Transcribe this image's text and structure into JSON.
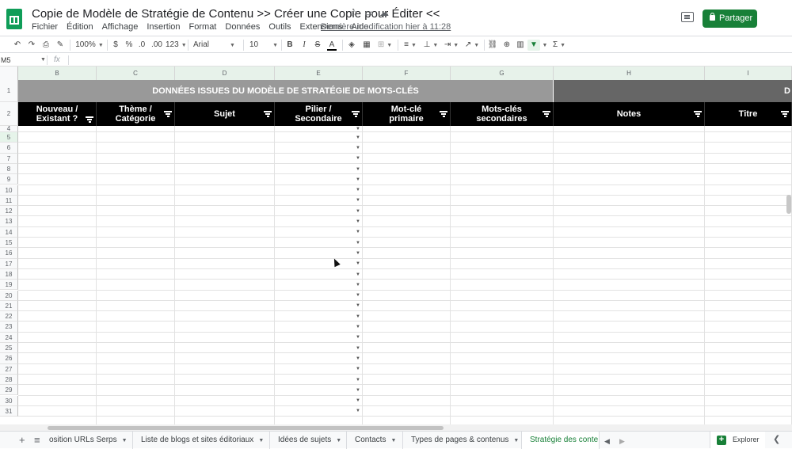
{
  "app": {
    "title": "Copie de Modèle de Stratégie de Contenu >> Créer une Copie pour Éditer <<",
    "last_edit": "Dernière modification hier à 11:28",
    "share_label": "Partager"
  },
  "menu": [
    "Fichier",
    "Édition",
    "Affichage",
    "Insertion",
    "Format",
    "Données",
    "Outils",
    "Extensions",
    "Aide"
  ],
  "toolbar": {
    "zoom": "100%",
    "currency": "$",
    "percent": "%",
    "dec_decrease": ".0",
    "dec_increase": ".00",
    "number_format": "123",
    "font": "Arial",
    "font_size": "10",
    "bold": "B",
    "italic": "I",
    "strike": "S",
    "text_color": "A",
    "sum": "Σ"
  },
  "formula_bar": {
    "cell_ref": "M5",
    "fx": "fx"
  },
  "columns": [
    "B",
    "C",
    "D",
    "E",
    "F",
    "G",
    "H",
    "I"
  ],
  "band": {
    "main": "DONNÉES ISSUES DU MODÈLE DE STRATÉGIE DE MOTS-CLÉS",
    "right": "D"
  },
  "header_row": [
    "Nouveau / Existant ?",
    "Thème / Catégorie",
    "Sujet",
    "Pilier / Secondaire",
    "Mot-clé primaire",
    "Mots-clés secondaires",
    "Notes",
    "Titre"
  ],
  "row_numbers": [
    "1",
    "2",
    "4",
    "5",
    "6",
    "7",
    "8",
    "9",
    "10",
    "11",
    "12",
    "13",
    "14",
    "15",
    "16",
    "17",
    "18",
    "19",
    "20",
    "21",
    "22",
    "23",
    "24",
    "25",
    "26",
    "27",
    "28",
    "29",
    "30",
    "31"
  ],
  "sheet_tabs": [
    "osition URLs Serps",
    "Liste de blogs et sites éditoriaux",
    "Idées de sujets",
    "Contacts",
    "Types de pages & contenus",
    "Stratégie des conte"
  ],
  "explore_label": "Explorer",
  "colors": {
    "brand_green": "#188038",
    "band_gray": "#999999",
    "band_dark": "#666666",
    "header_black": "#000000"
  }
}
